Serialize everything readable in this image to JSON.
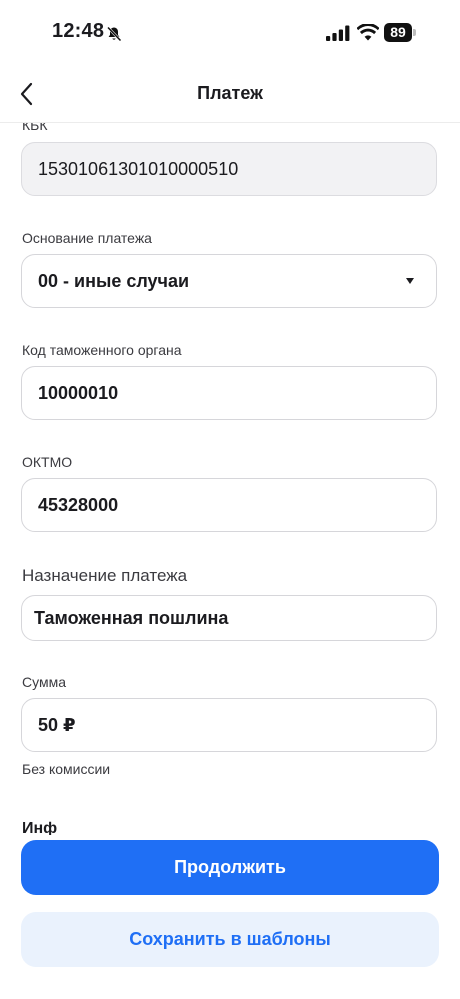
{
  "status_bar": {
    "time": "12:48",
    "battery": "89",
    "icons": [
      "bell-off-icon",
      "signal-icon",
      "wifi-icon",
      "battery-icon"
    ]
  },
  "nav": {
    "title": "Платеж",
    "back_icon": "chevron-left-icon"
  },
  "form": {
    "kbk": {
      "label": "КБК",
      "value": "15301061301010000510"
    },
    "payment_basis": {
      "label": "Основание платежа",
      "value": "00 - иные случаи",
      "icon": "dropdown-arrow-icon"
    },
    "customs_code": {
      "label": "Код таможенного органа",
      "value": "10000010"
    },
    "oktmo": {
      "label": "ОКТМО",
      "value": "45328000"
    },
    "purpose": {
      "label": "Назначение платежа",
      "value": "Таможенная пошлина"
    },
    "amount": {
      "label": "Сумма",
      "value": "50 ₽",
      "hint": "Без комиссии"
    },
    "cut_off_label": "Инф"
  },
  "actions": {
    "continue_label": "Продолжить",
    "save_template_label": "Сохранить в шаблоны"
  },
  "colors": {
    "accent": "#1f6ff5",
    "secondary_bg": "#eaf2fd"
  }
}
